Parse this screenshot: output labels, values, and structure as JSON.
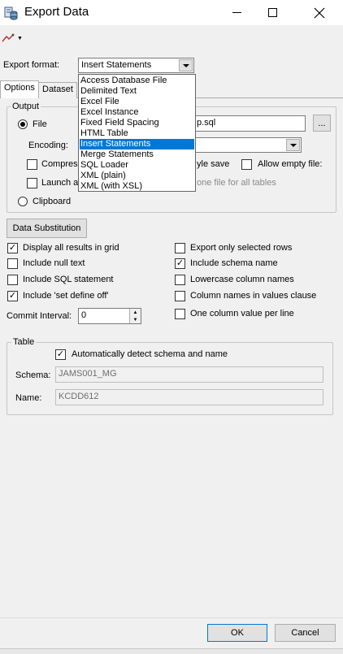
{
  "window": {
    "title": "Export Data",
    "icon": "export-data-icon",
    "controls": {
      "minimize": "minimize-icon",
      "maximize": "maximize-icon",
      "close": "close-icon"
    }
  },
  "toolbar": {
    "tool_icon": "pen-tool-icon",
    "chevron": "▼"
  },
  "export_format": {
    "label": "Export format:",
    "selected": "Insert Statements",
    "options": [
      "Access Database File",
      "Delimited Text",
      "Excel File",
      "Excel Instance",
      "Fixed Field Spacing",
      "HTML Table",
      "Insert Statements",
      "Merge Statements",
      "SQL Loader",
      "XML (plain)",
      "XML (with XSL)"
    ]
  },
  "tabs": [
    {
      "label": "Options",
      "active": true
    },
    {
      "label": "Dataset",
      "active": false
    }
  ],
  "output": {
    "title": "Output",
    "file_label": "File",
    "file_value_visible": "p.sql",
    "browse_label": "...",
    "encoding_label": "Encoding:",
    "compress_label": "Compress",
    "launch_label": "Launch a",
    "style_save_label": "yle save",
    "allow_empty_label": "Allow empty file:",
    "one_file_label": "one file for all tables",
    "clipboard_label": "Clipboard"
  },
  "data_substitution": {
    "label": "Data Substitution"
  },
  "options_left": [
    {
      "label": "Display all results in grid",
      "checked": true
    },
    {
      "label": "Include null text",
      "checked": false
    },
    {
      "label": "Include SQL statement",
      "checked": false
    },
    {
      "label": "Include 'set define off'",
      "checked": true
    }
  ],
  "options_right": [
    {
      "label": "Export only selected rows",
      "checked": false
    },
    {
      "label": "Include schema name",
      "checked": true
    },
    {
      "label": "Lowercase column names",
      "checked": false
    },
    {
      "label": "Column names in values clause",
      "checked": false
    },
    {
      "label": "One column value per line",
      "checked": false
    }
  ],
  "commit_interval": {
    "label": "Commit Interval:",
    "value": "0"
  },
  "table": {
    "title": "Table",
    "auto_detect_label": "Automatically detect schema and name",
    "auto_detect_checked": true,
    "schema_label": "Schema:",
    "schema_value": "JAMS001_MG",
    "name_label": "Name:",
    "name_value": "KCDD612"
  },
  "footer": {
    "ok_label": "OK",
    "cancel_label": "Cancel"
  },
  "colors": {
    "selection": "#0078d7",
    "dialog_bg": "#f0f0f0"
  }
}
